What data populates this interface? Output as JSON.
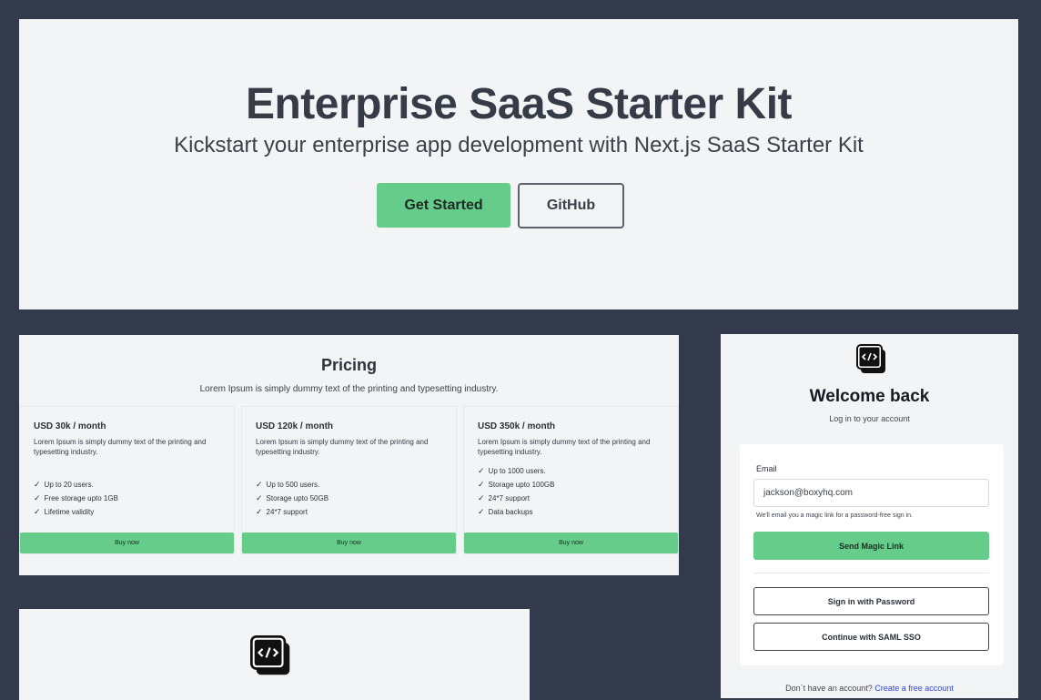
{
  "hero": {
    "title": "Enterprise SaaS Starter Kit",
    "subtitle": "Kickstart your enterprise app development with Next.js SaaS Starter Kit",
    "primary_button": "Get Started",
    "secondary_button": "GitHub"
  },
  "pricing": {
    "title": "Pricing",
    "subtitle": "Lorem Ipsum is simply dummy text of the printing and typesetting industry.",
    "plans": [
      {
        "price": "USD 30k / month",
        "description": "Lorem Ipsum is simply dummy text of the printing and typesetting industry.",
        "features": [
          "Up to 20 users.",
          "Free storage upto 1GB",
          "Lifetime validity"
        ],
        "button": "Buy now"
      },
      {
        "price": "USD 120k / month",
        "description": "Lorem Ipsum is simply dummy text of the printing and typesetting industry.",
        "features": [
          "Up to 500 users.",
          "Storage upto 50GB",
          "24*7 support"
        ],
        "button": "Buy now"
      },
      {
        "price": "USD 350k / month",
        "description": "Lorem Ipsum is simply dummy text of the printing and typesetting industry.",
        "features": [
          "Up to 1000 users.",
          "Storage upto 100GB",
          "24*7 support",
          "Data backups"
        ],
        "button": "Buy now"
      }
    ]
  },
  "login": {
    "logo_icon": "code-brackets-logo-icon",
    "title": "Welcome back",
    "subtitle": "Log in to your account",
    "email_label": "Email",
    "email_value": "jackson@boxyhq.com",
    "hint": "We'll email you a magic link for a password-free sign in.",
    "send_button": "Send Magic Link",
    "password_button": "Sign in with Password",
    "sso_button": "Continue with SAML SSO",
    "footer_text": "Don`t have an account?",
    "footer_link": "Create a free account"
  },
  "bottom": {
    "logo_icon": "code-brackets-logo-icon"
  },
  "colors": {
    "background": "#323a4b",
    "panel": "#f3f4f6",
    "accent_green": "#65cd89",
    "link_blue": "#3145d6"
  }
}
